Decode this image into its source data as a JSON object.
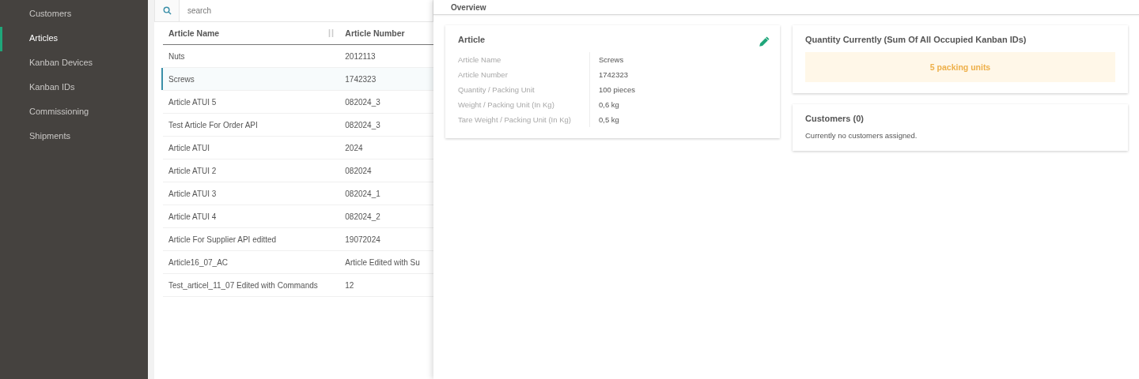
{
  "sidebar": {
    "items": [
      {
        "label": "Customers",
        "selected": false
      },
      {
        "label": "Articles",
        "selected": true
      },
      {
        "label": "Kanban Devices",
        "selected": false
      },
      {
        "label": "Kanban IDs",
        "selected": false
      },
      {
        "label": "Commissioning",
        "selected": false
      },
      {
        "label": "Shipments",
        "selected": false
      }
    ]
  },
  "search": {
    "placeholder": "search"
  },
  "table": {
    "columns": [
      "Article Name",
      "Article Number"
    ],
    "rows": [
      {
        "cells": [
          "Nuts",
          "2012113"
        ],
        "selected": false
      },
      {
        "cells": [
          "Screws",
          "1742323"
        ],
        "selected": true
      },
      {
        "cells": [
          "Article ATUI 5",
          "082024_3"
        ],
        "selected": false
      },
      {
        "cells": [
          "Test Article For Order API",
          "082024_3"
        ],
        "selected": false
      },
      {
        "cells": [
          "Article ATUI",
          "2024"
        ],
        "selected": false
      },
      {
        "cells": [
          "Article ATUI 2",
          "082024"
        ],
        "selected": false
      },
      {
        "cells": [
          "Article ATUI 3",
          "082024_1"
        ],
        "selected": false
      },
      {
        "cells": [
          "Article ATUI 4",
          "082024_2"
        ],
        "selected": false
      },
      {
        "cells": [
          "Article For Supplier API editted",
          "19072024"
        ],
        "selected": false
      },
      {
        "cells": [
          "Article16_07_AC",
          "Article Edited with Su"
        ],
        "selected": false
      },
      {
        "cells": [
          "Test_articel_11_07 Edited with Commands",
          "12"
        ],
        "selected": false
      }
    ]
  },
  "overview": {
    "title": "Overview",
    "article_card": {
      "title": "Article",
      "fields": [
        {
          "label": "Article Name",
          "value": "Screws"
        },
        {
          "label": "Article Number",
          "value": "1742323"
        },
        {
          "label": "Quantity / Packing Unit",
          "value": "100 pieces"
        },
        {
          "label": "Weight / Packing Unit (In Kg)",
          "value": "0,6 kg"
        },
        {
          "label": "Tare Weight / Packing Unit (In Kg)",
          "value": "0,5 kg"
        }
      ]
    },
    "quantity_card": {
      "title": "Quantity Currently (Sum Of All Occupied Kanban IDs)",
      "value": "5 packing units"
    },
    "customers_card": {
      "title": "Customers (0)",
      "message": "Currently no customers assigned."
    }
  }
}
